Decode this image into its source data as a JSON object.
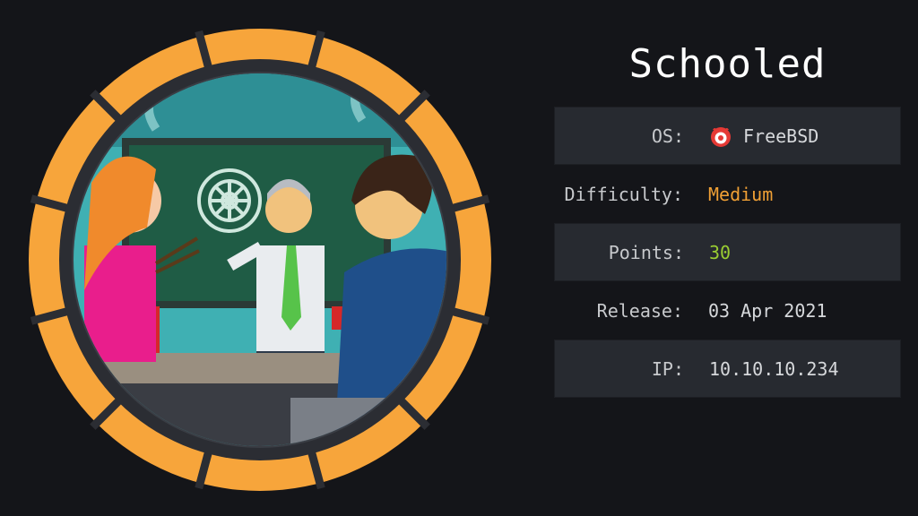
{
  "machine": {
    "name": "Schooled"
  },
  "info": {
    "os_label": "OS:",
    "os_value": "FreeBSD",
    "os_icon": "freebsd-icon",
    "difficulty_label": "Difficulty:",
    "difficulty_value": "Medium",
    "points_label": "Points:",
    "points_value": "30",
    "release_label": "Release:",
    "release_value": "03 Apr 2021",
    "ip_label": "IP:",
    "ip_value": "10.10.10.234"
  },
  "colors": {
    "background": "#141519",
    "ring": "#f7a53b",
    "difficulty_medium": "#f0a035",
    "points": "#9acd32",
    "row_shade": "#272a30"
  }
}
